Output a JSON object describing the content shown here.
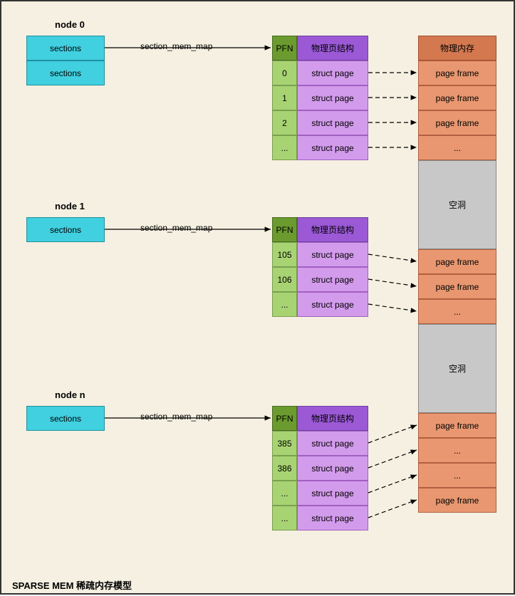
{
  "caption": "SPARSE MEM 稀疏内存模型",
  "nodes": [
    {
      "label": "node 0",
      "sections": [
        "sections",
        "sections"
      ],
      "arrow_label": "section_mem_map"
    },
    {
      "label": "node 1",
      "sections": [
        "sections"
      ],
      "arrow_label": "section_mem_map"
    },
    {
      "label": "node n",
      "sections": [
        "sections"
      ],
      "arrow_label": "section_mem_map"
    }
  ],
  "pfn_header": "PFN",
  "struct_header": "物理页结构",
  "mem_header": "物理内存",
  "table0": {
    "rows": [
      {
        "pfn": "0",
        "struct": "struct page"
      },
      {
        "pfn": "1",
        "struct": "struct page"
      },
      {
        "pfn": "2",
        "struct": "struct page"
      },
      {
        "pfn": "...",
        "struct": "struct page"
      }
    ]
  },
  "table1": {
    "rows": [
      {
        "pfn": "105",
        "struct": "struct page"
      },
      {
        "pfn": "106",
        "struct": "struct page"
      },
      {
        "pfn": "...",
        "struct": "struct page"
      }
    ]
  },
  "table2": {
    "rows": [
      {
        "pfn": "385",
        "struct": "struct page"
      },
      {
        "pfn": "386",
        "struct": "struct page"
      },
      {
        "pfn": "...",
        "struct": "struct page"
      },
      {
        "pfn": "...",
        "struct": "struct page"
      }
    ]
  },
  "mem_column": [
    {
      "type": "frame",
      "label": "page frame"
    },
    {
      "type": "frame",
      "label": "page frame"
    },
    {
      "type": "frame",
      "label": "page frame"
    },
    {
      "type": "frame",
      "label": "..."
    },
    {
      "type": "hole",
      "label": "空洞",
      "height": 125
    },
    {
      "type": "frame",
      "label": "page frame"
    },
    {
      "type": "frame",
      "label": "page frame"
    },
    {
      "type": "frame",
      "label": "..."
    },
    {
      "type": "hole",
      "label": "空洞",
      "height": 125
    },
    {
      "type": "frame",
      "label": "page frame"
    },
    {
      "type": "frame",
      "label": "..."
    },
    {
      "type": "frame",
      "label": "..."
    },
    {
      "type": "frame",
      "label": "page frame"
    }
  ]
}
